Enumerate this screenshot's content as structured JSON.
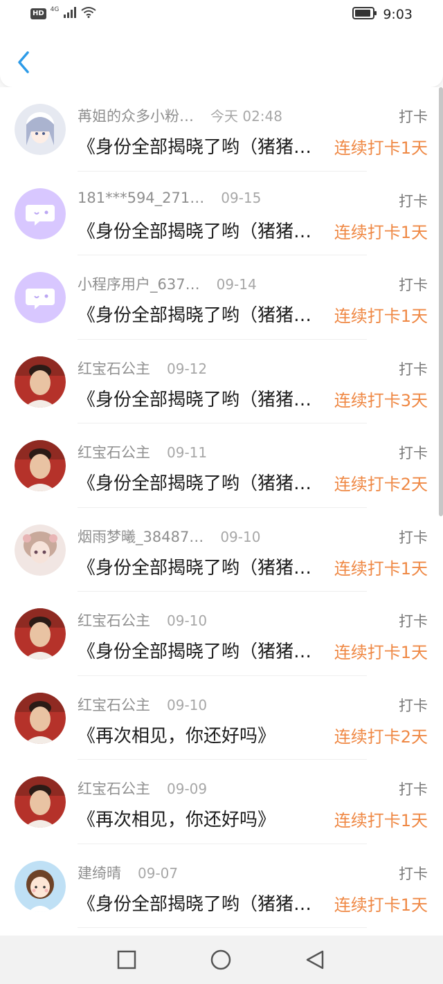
{
  "status_bar": {
    "hd": "HD",
    "network": "4G",
    "time": "9:03"
  },
  "items": [
    {
      "name": "苒姐的众多小粉…",
      "date": "今天 02:48",
      "type": "打卡",
      "title": "《身份全部揭晓了哟（猪猪…",
      "streak": "连续打卡1天",
      "avatar": "anime-girl-avatar"
    },
    {
      "name": "181***594_271…",
      "date": "09-15",
      "type": "打卡",
      "title": "《身份全部揭晓了哟（猪猪…",
      "streak": "连续打卡1天",
      "avatar": "chat-bubble-avatar"
    },
    {
      "name": "小程序用户_637…",
      "date": "09-14",
      "type": "打卡",
      "title": "《身份全部揭晓了哟（猪猪…",
      "streak": "连续打卡1天",
      "avatar": "chat-bubble-avatar"
    },
    {
      "name": "红宝石公主",
      "date": "09-12",
      "type": "打卡",
      "title": "《身份全部揭晓了哟（猪猪…",
      "streak": "连续打卡3天",
      "avatar": "photo-avatar"
    },
    {
      "name": "红宝石公主",
      "date": "09-11",
      "type": "打卡",
      "title": "《身份全部揭晓了哟（猪猪…",
      "streak": "连续打卡2天",
      "avatar": "photo-avatar"
    },
    {
      "name": "烟雨梦曦_38487…",
      "date": "09-10",
      "type": "打卡",
      "title": "《身份全部揭晓了哟（猪猪…",
      "streak": "连续打卡1天",
      "avatar": "doll-avatar"
    },
    {
      "name": "红宝石公主",
      "date": "09-10",
      "type": "打卡",
      "title": "《身份全部揭晓了哟（猪猪…",
      "streak": "连续打卡1天",
      "avatar": "photo-avatar"
    },
    {
      "name": "红宝石公主",
      "date": "09-10",
      "type": "打卡",
      "title": "《再次相见，你还好吗》",
      "streak": "连续打卡2天",
      "avatar": "photo-avatar"
    },
    {
      "name": "红宝石公主",
      "date": "09-09",
      "type": "打卡",
      "title": "《再次相见，你还好吗》",
      "streak": "连续打卡1天",
      "avatar": "photo-avatar"
    },
    {
      "name": "建绮晴",
      "date": "09-07",
      "type": "打卡",
      "title": "《身份全部揭晓了哟（猪猪…",
      "streak": "连续打卡1天",
      "avatar": "cartoon-girl-avatar"
    }
  ]
}
